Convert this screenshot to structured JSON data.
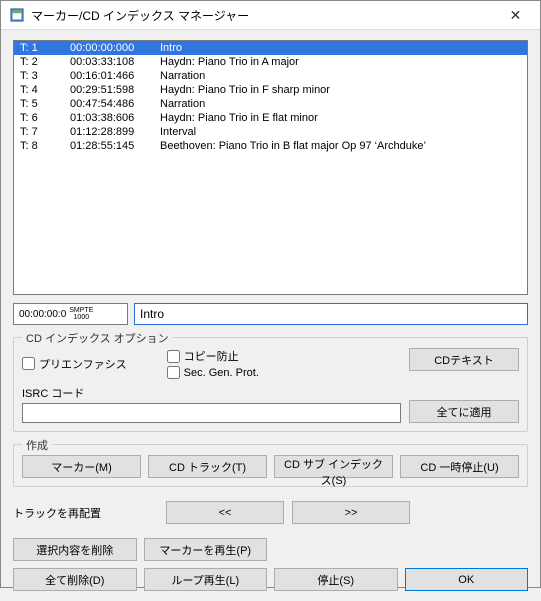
{
  "titlebar": {
    "title": "マーカー/CD インデックス マネージャー"
  },
  "tracks": [
    {
      "t": "T: 1",
      "time": "00:00:00:000",
      "name": "Intro",
      "selected": true
    },
    {
      "t": "T: 2",
      "time": "00:03:33:108",
      "name": "Haydn: Piano Trio in A major"
    },
    {
      "t": "T: 3",
      "time": "00:16:01:466",
      "name": "Narration"
    },
    {
      "t": "T: 4",
      "time": "00:29:51:598",
      "name": "Haydn: Piano Trio in F sharp minor"
    },
    {
      "t": "T: 5",
      "time": "00:47:54:486",
      "name": "Narration"
    },
    {
      "t": "T: 6",
      "time": "01:03:38:606",
      "name": "Haydn: Piano Trio in E flat minor"
    },
    {
      "t": "T: 7",
      "time": "01:12:28:899",
      "name": "Interval"
    },
    {
      "t": "T: 8",
      "time": "01:28:55:145",
      "name": "Beethoven: Piano Trio in B flat major Op 97 ‘Archduke’"
    }
  ],
  "editor": {
    "time": "00:00:00:0",
    "smpte1": "SMPTE",
    "smpte2": "1000",
    "name": "Intro"
  },
  "cd_opts": {
    "title": "CD インデックス オプション",
    "pre_emphasis": "プリエンファシス",
    "copy_protect": "コピー防止",
    "sec_gen": "Sec. Gen. Prot.",
    "isrc_label": "ISRC コード",
    "isrc_value": "",
    "cd_text": "CDテキスト",
    "apply_all": "全てに適用"
  },
  "create": {
    "title": "作成",
    "marker": "マーカー(M)",
    "cd_track": "CD トラック(T)",
    "cd_subindex": "CD サブ インデックス(S)",
    "cd_pause": "CD 一時停止(U)"
  },
  "rearrange": {
    "label": "トラックを再配置",
    "prev": "<<",
    "next": ">>"
  },
  "bottom": {
    "delete_selection": "選択内容を削除",
    "play_marker": "マーカーを再生(P)",
    "delete_all": "全て削除(D)",
    "loop_play": "ループ再生(L)",
    "stop": "停止(S)",
    "ok": "OK"
  }
}
